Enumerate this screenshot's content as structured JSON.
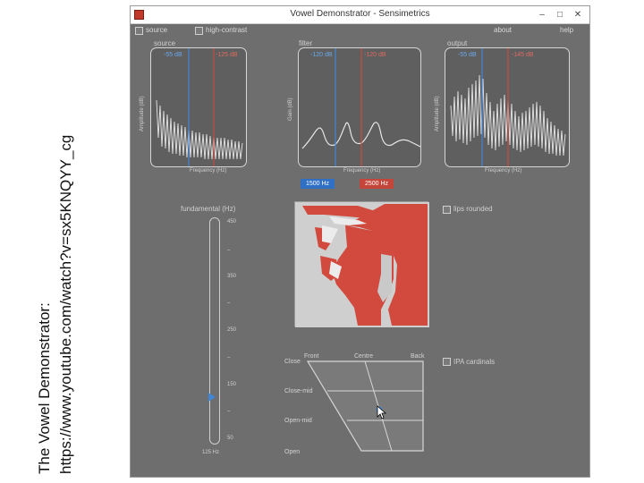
{
  "caption": {
    "line1": "The Vowel Demonstrator:",
    "line2": "https://www.youtube.com/watch?v=sx5KNQYY_cg"
  },
  "window": {
    "title": "Vowel Demonstrator - Sensimetrics",
    "buttons": {
      "minimize": "–",
      "maximize": "□",
      "close": "✕"
    }
  },
  "menubar": {
    "source_check": "source",
    "high_contrast_check": "high-contrast",
    "about": "about",
    "help": "help"
  },
  "panels": {
    "source": {
      "label": "source",
      "db_blue": "-55 dB",
      "db_red": "-125 dB",
      "ylabel": "Amplitude (dB)",
      "xlabel": "Frequency (Hz)"
    },
    "filter": {
      "label": "filter",
      "db_blue": "-120 dB",
      "db_red": "-120 dB",
      "ylabel": "Gain (dB)",
      "xlabel": "Frequency (Hz)"
    },
    "output": {
      "label": "output",
      "db_blue": "-55 dB",
      "db_red": "-145 dB",
      "ylabel": "Amplitude (dB)",
      "xlabel": "Frequency (Hz)"
    }
  },
  "formants": {
    "f1": "1500 Hz",
    "f2": "2500 Hz"
  },
  "fundamental": {
    "title": "fundamental (Hz)",
    "ticks": [
      "450",
      "350",
      "250",
      "150",
      "50"
    ],
    "value": "125 Hz",
    "level_fraction": 0.21
  },
  "lips_rounded": "lips rounded",
  "ipa_cardinals": "IPA cardinals",
  "quadrilateral": {
    "columns": [
      "Front",
      "Centre",
      "Back"
    ],
    "rows": [
      "Close",
      "Close-mid",
      "Open-mid",
      "Open"
    ]
  },
  "colors": {
    "blue_marker": "#3f86d6",
    "red_marker": "#c94a3f",
    "tract_red": "#d24a3e",
    "window_bg": "#6e6e6e"
  }
}
